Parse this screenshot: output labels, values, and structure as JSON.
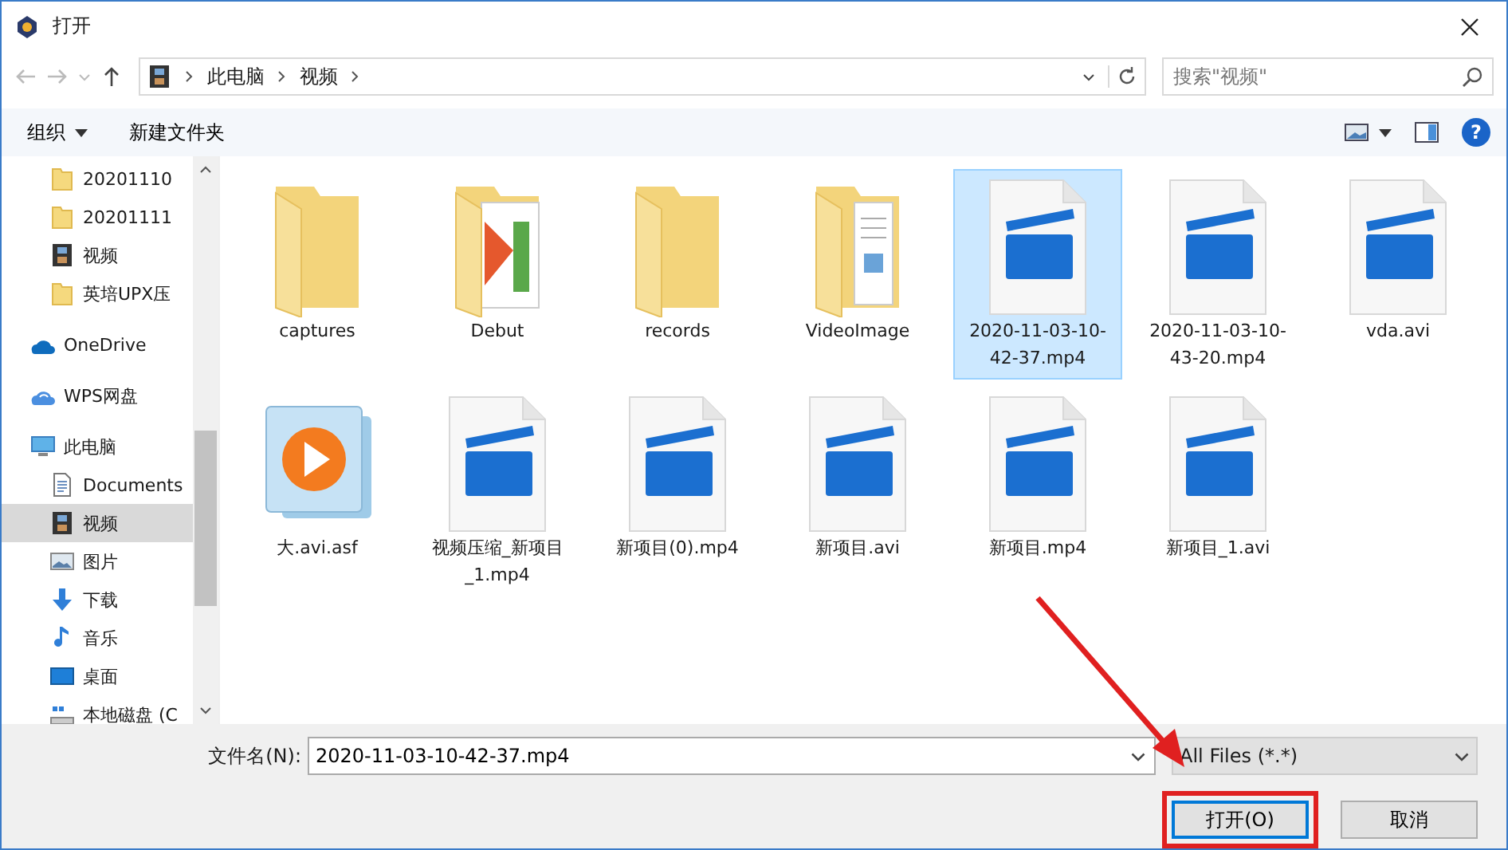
{
  "window": {
    "title": "打开"
  },
  "address": {
    "path": [
      "此电脑",
      "视频"
    ],
    "search_placeholder": "搜索\"视频\""
  },
  "toolbar": {
    "buttons": [
      "组织",
      "新建文件夹"
    ],
    "help_glyph": "?"
  },
  "sidebar": {
    "scrolled_items": [
      {
        "label": "20201110",
        "kind": "folder",
        "selected": false
      },
      {
        "label": "20201111",
        "kind": "folder",
        "selected": false
      },
      {
        "label": "视频",
        "kind": "video",
        "selected": false
      },
      {
        "label": "英培UPX压",
        "kind": "folder",
        "selected": false
      }
    ],
    "roots": [
      {
        "label": "OneDrive",
        "kind": "onedrive",
        "selected": false
      },
      {
        "label": "WPS网盘",
        "kind": "cloud",
        "selected": false
      },
      {
        "label": "此电脑",
        "kind": "pc",
        "selected": false,
        "children": [
          {
            "label": "Documents",
            "kind": "document",
            "selected": false
          },
          {
            "label": "视频",
            "kind": "video",
            "selected": true
          },
          {
            "label": "图片",
            "kind": "picture",
            "selected": false
          },
          {
            "label": "下载",
            "kind": "download",
            "selected": false
          },
          {
            "label": "音乐",
            "kind": "music",
            "selected": false
          },
          {
            "label": "桌面",
            "kind": "desktop",
            "selected": false
          },
          {
            "label": "本地磁盘 (C",
            "kind": "drive",
            "selected": false
          }
        ]
      }
    ]
  },
  "files": [
    {
      "name": "captures",
      "kind": "folder",
      "selected": false
    },
    {
      "name": "Debut",
      "kind": "media-folder",
      "selected": false
    },
    {
      "name": "records",
      "kind": "folder",
      "selected": false
    },
    {
      "name": "VideoImage",
      "kind": "doc-folder",
      "selected": false
    },
    {
      "name": "2020-11-03-10-42-37.mp4",
      "kind": "video",
      "selected": true
    },
    {
      "name": "2020-11-03-10-43-20.mp4",
      "kind": "video",
      "selected": false
    },
    {
      "name": "vda.avi",
      "kind": "video",
      "selected": false
    },
    {
      "name": "大.avi.asf",
      "kind": "player",
      "selected": false
    },
    {
      "name": "视频压缩_新项目_1.mp4",
      "kind": "video",
      "selected": false
    },
    {
      "name": "新项目(0).mp4",
      "kind": "video",
      "selected": false
    },
    {
      "name": "新项目.avi",
      "kind": "video",
      "selected": false
    },
    {
      "name": "新项目.mp4",
      "kind": "video",
      "selected": false
    },
    {
      "name": "新项目_1.avi",
      "kind": "video",
      "selected": false
    }
  ],
  "footer": {
    "filename_label": "文件名(N):",
    "filename": "2020-11-03-10-42-37.mp4",
    "filter": "All Files (*.*)",
    "open_button": "打开(O)",
    "cancel_button": "取消",
    "open_highlighted": true
  }
}
